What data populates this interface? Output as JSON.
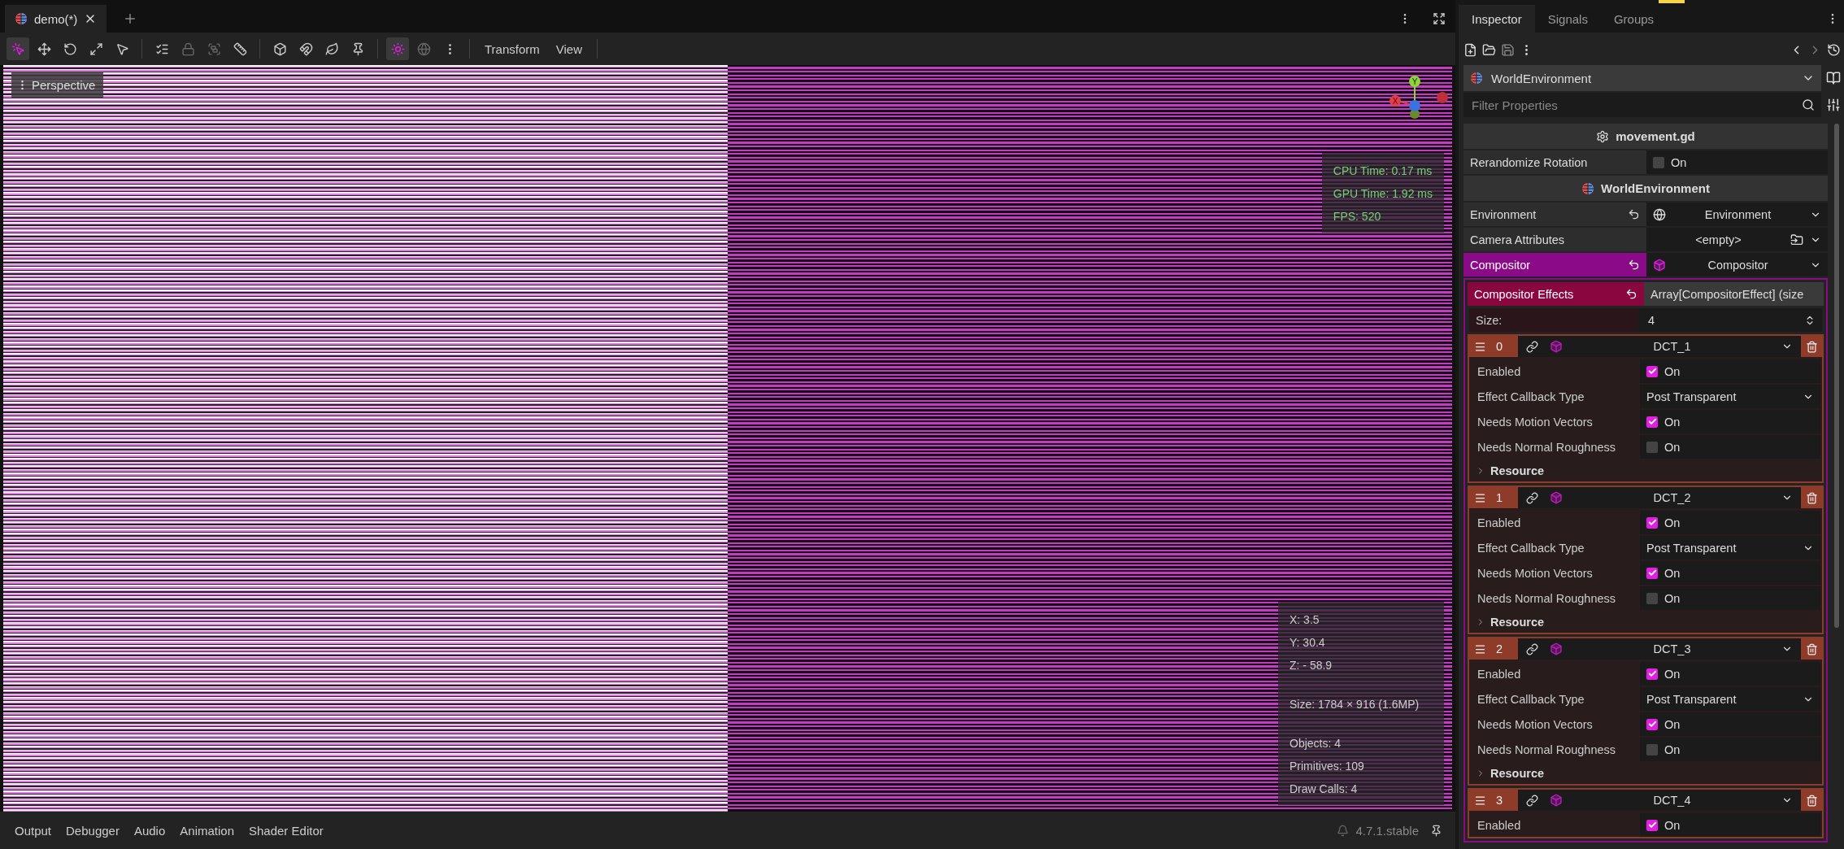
{
  "scene_tabs": [
    {
      "label": "demo(*)",
      "selected": true
    }
  ],
  "toolbar": {
    "tools": [
      {
        "kind": "select",
        "selected": true,
        "disabled": false
      },
      {
        "kind": "move",
        "selected": false,
        "disabled": false
      },
      {
        "kind": "rotate",
        "selected": false,
        "disabled": false
      },
      {
        "kind": "scale",
        "selected": false,
        "disabled": false
      },
      {
        "kind": "pointer",
        "selected": false,
        "disabled": false
      },
      {
        "kind": "list",
        "selected": false,
        "disabled": false
      },
      {
        "kind": "lock",
        "selected": false,
        "disabled": true
      },
      {
        "kind": "group",
        "selected": false,
        "disabled": true
      },
      {
        "kind": "ruler",
        "selected": false,
        "disabled": false
      },
      {
        "kind": "cube",
        "selected": false,
        "disabled": false
      },
      {
        "kind": "magnet",
        "selected": false,
        "disabled": false
      },
      {
        "kind": "leaf",
        "selected": false,
        "disabled": false
      },
      {
        "kind": "pin",
        "selected": false,
        "disabled": false
      },
      {
        "kind": "sun",
        "selected": true,
        "disabled": false
      },
      {
        "kind": "globe",
        "selected": false,
        "disabled": true
      },
      {
        "kind": "more",
        "selected": false,
        "disabled": false
      }
    ],
    "menus": [
      "Transform",
      "View"
    ]
  },
  "viewport": {
    "view_menu": "Perspective",
    "gizmo_axes": [
      "Y",
      "X"
    ],
    "stats": [
      "CPU Time: 0.17 ms",
      "GPU Time: 1.92 ms",
      "FPS: 520"
    ],
    "info": [
      [
        "X: 3.5",
        "Y: 30.4",
        "Z: - 58.9"
      ],
      [
        "Size: 1784 × 916 (1.6MP)"
      ],
      [
        "Objects: 4",
        "Primitives: 109",
        "Draw Calls: 4"
      ]
    ]
  },
  "bottom_panel": {
    "tabs": [
      "Output",
      "Debugger",
      "Audio",
      "Animation",
      "Shader Editor"
    ],
    "version": "4.7.1.stable"
  },
  "inspector": {
    "tabs": [
      {
        "label": "Inspector",
        "selected": true
      },
      {
        "label": "Signals",
        "selected": false
      },
      {
        "label": "Groups",
        "selected": false
      }
    ],
    "node": "WorldEnvironment",
    "filter_placeholder": "Filter Properties",
    "properties": [
      {
        "kind": "header",
        "label": "movement.gd"
      },
      {
        "kind": "check",
        "label": "Rerandomize Rotation",
        "checked": false,
        "value": "On"
      },
      {
        "kind": "header",
        "label": "WorldEnvironment"
      },
      {
        "kind": "resource",
        "label": "Environment",
        "value": "Environment",
        "revertable": true,
        "highlighted": false
      },
      {
        "kind": "resource",
        "label": "Camera Attributes",
        "value": "<empty>",
        "revertable": false,
        "highlighted": false
      },
      {
        "kind": "resource",
        "label": "Compositor",
        "value": "Compositor",
        "revertable": true,
        "highlighted": true
      }
    ],
    "effects": {
      "label": "Compositor Effects",
      "value": "Array[CompositorEffect] (size",
      "size_label": "Size:",
      "size": "4",
      "items": [
        {
          "index": "0",
          "name": "DCT_1",
          "section": "Resource",
          "properties": [
            {
              "kind": "check",
              "label": "Enabled",
              "checked": true,
              "value": "On"
            },
            {
              "kind": "enum",
              "label": "Effect Callback Type",
              "value": "Post Transparent"
            },
            {
              "kind": "check",
              "label": "Needs Motion Vectors",
              "checked": true,
              "value": "On"
            },
            {
              "kind": "check",
              "label": "Needs Normal Roughness",
              "checked": false,
              "value": "On"
            }
          ]
        },
        {
          "index": "1",
          "name": "DCT_2",
          "section": "Resource",
          "properties": [
            {
              "kind": "check",
              "label": "Enabled",
              "checked": true,
              "value": "On"
            },
            {
              "kind": "enum",
              "label": "Effect Callback Type",
              "value": "Post Transparent"
            },
            {
              "kind": "check",
              "label": "Needs Motion Vectors",
              "checked": true,
              "value": "On"
            },
            {
              "kind": "check",
              "label": "Needs Normal Roughness",
              "checked": false,
              "value": "On"
            }
          ]
        },
        {
          "index": "2",
          "name": "DCT_3",
          "section": "Resource",
          "properties": [
            {
              "kind": "check",
              "label": "Enabled",
              "checked": true,
              "value": "On"
            },
            {
              "kind": "enum",
              "label": "Effect Callback Type",
              "value": "Post Transparent"
            },
            {
              "kind": "check",
              "label": "Needs Motion Vectors",
              "checked": true,
              "value": "On"
            },
            {
              "kind": "check",
              "label": "Needs Normal Roughness",
              "checked": false,
              "value": "On"
            }
          ]
        },
        {
          "index": "3",
          "name": "DCT_4",
          "properties": [
            {
              "kind": "check",
              "label": "Enabled",
              "checked": true,
              "value": "On"
            }
          ]
        }
      ]
    }
  }
}
